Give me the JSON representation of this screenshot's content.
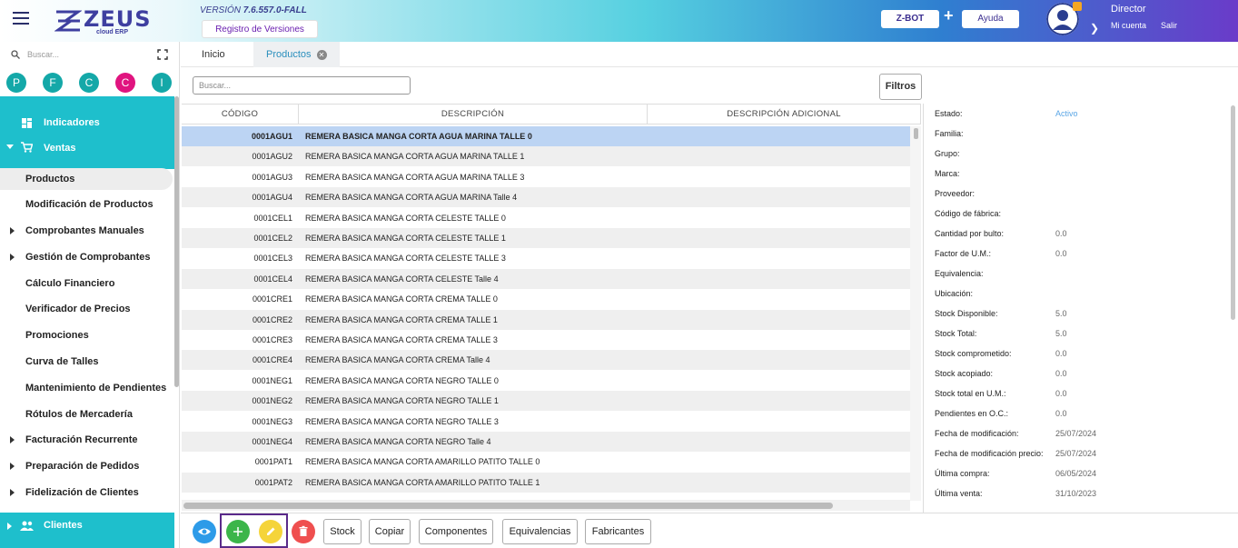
{
  "app": {
    "version_prefix": "VERSIÓN",
    "version": "7.6.557.0-FALL",
    "logo_text": "ZEUS",
    "logo_sub": "cloud ERP",
    "registro_label": "Registro de Versiones",
    "zbot_label": "Z-BOT",
    "plus": "+",
    "ayuda_label": "Ayuda",
    "user_name": "Director",
    "mi_cuenta": "Mi cuenta",
    "salir": "Salir"
  },
  "sidebar": {
    "search_placeholder": "Buscar...",
    "circles": [
      {
        "letter": "P",
        "color": "#14a8a8"
      },
      {
        "letter": "F",
        "color": "#14a8a8"
      },
      {
        "letter": "C",
        "color": "#14a8a8"
      },
      {
        "letter": "C",
        "color": "#e0147f"
      },
      {
        "letter": "I",
        "color": "#14a8a8"
      }
    ],
    "indicadores": "Indicadores",
    "ventas": "Ventas",
    "items": [
      "Productos",
      "Modificación de Productos",
      "Comprobantes Manuales",
      "Gestión de Comprobantes",
      "Cálculo Financiero",
      "Verificador de Precios",
      "Promociones",
      "Curva de Talles",
      "Mantenimiento de Pendientes",
      "Rótulos de Mercadería",
      "Facturación Recurrente",
      "Preparación de Pedidos",
      "Fidelización de Clientes"
    ],
    "clientes": "Clientes"
  },
  "tabs": {
    "inicio": "Inicio",
    "productos": "Productos"
  },
  "grid": {
    "search_placeholder": "Buscar...",
    "filtros": "Filtros",
    "columns": [
      "CÓDIGO",
      "DESCRIPCIÓN",
      "DESCRIPCIÓN ADICIONAL"
    ],
    "rows": [
      {
        "code": "0001AGU1",
        "desc": "REMERA BASICA MANGA CORTA AGUA MARINA TALLE 0"
      },
      {
        "code": "0001AGU2",
        "desc": "REMERA BASICA MANGA CORTA AGUA MARINA TALLE 1"
      },
      {
        "code": "0001AGU3",
        "desc": "REMERA BASICA MANGA CORTA AGUA MARINA TALLE 3"
      },
      {
        "code": "0001AGU4",
        "desc": "REMERA BASICA MANGA CORTA AGUA MARINA Talle 4"
      },
      {
        "code": "0001CEL1",
        "desc": "REMERA BASICA MANGA CORTA CELESTE TALLE 0"
      },
      {
        "code": "0001CEL2",
        "desc": "REMERA BASICA MANGA CORTA CELESTE TALLE 1"
      },
      {
        "code": "0001CEL3",
        "desc": "REMERA BASICA MANGA CORTA CELESTE TALLE 3"
      },
      {
        "code": "0001CEL4",
        "desc": "REMERA BASICA MANGA CORTA CELESTE Talle 4"
      },
      {
        "code": "0001CRE1",
        "desc": "REMERA BASICA MANGA CORTA CREMA TALLE 0"
      },
      {
        "code": "0001CRE2",
        "desc": "REMERA BASICA MANGA CORTA CREMA TALLE 1"
      },
      {
        "code": "0001CRE3",
        "desc": "REMERA BASICA MANGA CORTA CREMA TALLE 3"
      },
      {
        "code": "0001CRE4",
        "desc": "REMERA BASICA MANGA CORTA CREMA Talle 4"
      },
      {
        "code": "0001NEG1",
        "desc": "REMERA BASICA MANGA CORTA NEGRO TALLE 0"
      },
      {
        "code": "0001NEG2",
        "desc": "REMERA BASICA MANGA CORTA NEGRO TALLE 1"
      },
      {
        "code": "0001NEG3",
        "desc": "REMERA BASICA MANGA CORTA NEGRO TALLE 3"
      },
      {
        "code": "0001NEG4",
        "desc": "REMERA BASICA MANGA CORTA NEGRO Talle 4"
      },
      {
        "code": "0001PAT1",
        "desc": "REMERA BASICA MANGA CORTA AMARILLO PATITO TALLE 0"
      },
      {
        "code": "0001PAT2",
        "desc": "REMERA BASICA MANGA CORTA AMARILLO PATITO TALLE 1"
      }
    ]
  },
  "detail": [
    {
      "label": "Estado:",
      "value": "Activo"
    },
    {
      "label": "Familia:",
      "value": ""
    },
    {
      "label": "Grupo:",
      "value": ""
    },
    {
      "label": "Marca:",
      "value": ""
    },
    {
      "label": "Proveedor:",
      "value": ""
    },
    {
      "label": "Código de fábrica:",
      "value": ""
    },
    {
      "label": "Cantidad por bulto:",
      "value": "0.0"
    },
    {
      "label": "Factor de U.M.:",
      "value": "0.0"
    },
    {
      "label": "Equivalencia:",
      "value": ""
    },
    {
      "label": "Ubicación:",
      "value": ""
    },
    {
      "label": "Stock Disponible:",
      "value": "5.0"
    },
    {
      "label": "Stock Total:",
      "value": "5.0"
    },
    {
      "label": "Stock comprometido:",
      "value": "0.0"
    },
    {
      "label": "Stock acopiado:",
      "value": "0.0"
    },
    {
      "label": "Stock total en U.M.:",
      "value": "0.0"
    },
    {
      "label": "Pendientes en O.C.:",
      "value": "0.0"
    },
    {
      "label": "Fecha de modificación:",
      "value": "25/07/2024"
    },
    {
      "label": "Fecha de modificación precio:",
      "value": "25/07/2024"
    },
    {
      "label": "Última compra:",
      "value": "06/05/2024"
    },
    {
      "label": "Última venta:",
      "value": "31/10/2023"
    }
  ],
  "bottom": {
    "stock": "Stock",
    "copiar": "Copiar",
    "componentes": "Componentes",
    "equivalencias": "Equivalencias",
    "fabricantes": "Fabricantes"
  },
  "colors": {
    "accent_cyan": "#1ebfcc",
    "selected_row": "#bcd4f3",
    "view_button": "#2d9be8",
    "add_button": "#3cb54a",
    "edit_button": "#f5d43a",
    "delete_button": "#ef4f4f",
    "highlight_border": "#5a2a8a",
    "estado_active": "#5aa6e6"
  }
}
